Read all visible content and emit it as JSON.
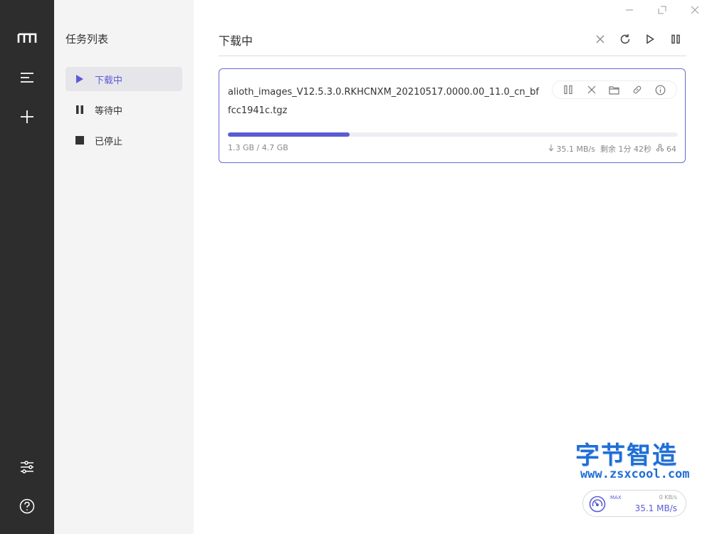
{
  "rail": {
    "icons": [
      "logo-icon",
      "menu-icon",
      "add-icon",
      "settings-icon",
      "help-icon"
    ]
  },
  "task_list": {
    "title": "任务列表",
    "items": [
      {
        "label": "下载中",
        "icon": "play-icon",
        "active": true
      },
      {
        "label": "等待中",
        "icon": "pause-icon",
        "active": false
      },
      {
        "label": "已停止",
        "icon": "stop-icon",
        "active": false
      }
    ]
  },
  "main": {
    "title": "下载中"
  },
  "task": {
    "filename": "alioth_images_V12.5.3.0.RKHCNXM_20210517.0000.00_11.0_cn_bffcc1941c.tgz",
    "size": "1.3 GB / 4.7 GB",
    "progress": 0.27,
    "speed": "35.1 MB/s",
    "remaining": "剩余 1分 42秒",
    "connections": "64"
  },
  "watermark": {
    "cn": "字节智造",
    "url": "www.zsxcool.com"
  },
  "speedometer": {
    "max_label": "MAX",
    "upload": "0 KB/s",
    "download": "35.1 MB/s"
  },
  "colors": {
    "accent": "#5b5bd6",
    "rail_bg": "#2d2d2d",
    "panel_bg": "#f4f4f5"
  }
}
